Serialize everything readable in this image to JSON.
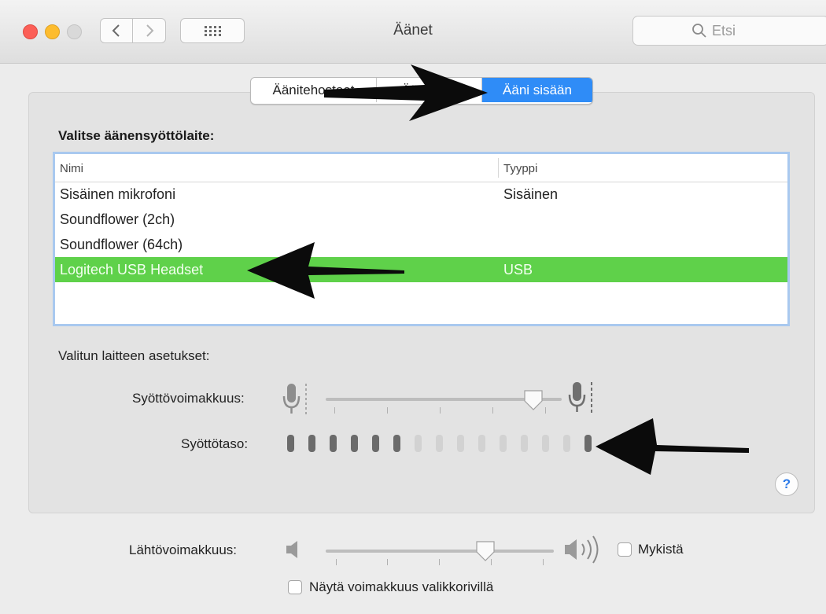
{
  "window": {
    "title": "Äänet",
    "search_placeholder": "Etsi"
  },
  "tabs": [
    {
      "label": "Äänitehosteet",
      "selected": false
    },
    {
      "label": "Ääni ulos",
      "selected": false
    },
    {
      "label": "Ääni sisään",
      "selected": true
    }
  ],
  "input": {
    "section_title": "Valitse äänensyöttölaite:",
    "columns": {
      "name": "Nimi",
      "type": "Tyyppi"
    },
    "devices": [
      {
        "name": "Sisäinen mikrofoni",
        "type": "Sisäinen",
        "selected": false
      },
      {
        "name": "Soundflower (2ch)",
        "type": "",
        "selected": false
      },
      {
        "name": "Soundflower (64ch)",
        "type": "",
        "selected": false
      },
      {
        "name": "Logitech USB Headset",
        "type": "USB",
        "selected": true
      }
    ],
    "settings_title": "Valitun laitteen asetukset:",
    "volume_label": "Syöttövoimakkuus:",
    "volume_level": 0.88,
    "level_label": "Syöttötaso:",
    "level_total_bars": 15,
    "level_active_bars": 6,
    "level_peak_bar": 15
  },
  "output": {
    "volume_label": "Lähtövoimakkuus:",
    "volume_level": 0.7,
    "mute_label": "Mykistä",
    "mute_checked": false,
    "show_in_menubar_label": "Näytä voimakkuus valikkorivillä",
    "show_in_menubar_checked": false
  },
  "colors": {
    "selected_row": "#5fd14a",
    "segment_selected": "#2f8cf7",
    "level_active": "#6b6b6b",
    "level_inactive": "#d2d2d2"
  }
}
